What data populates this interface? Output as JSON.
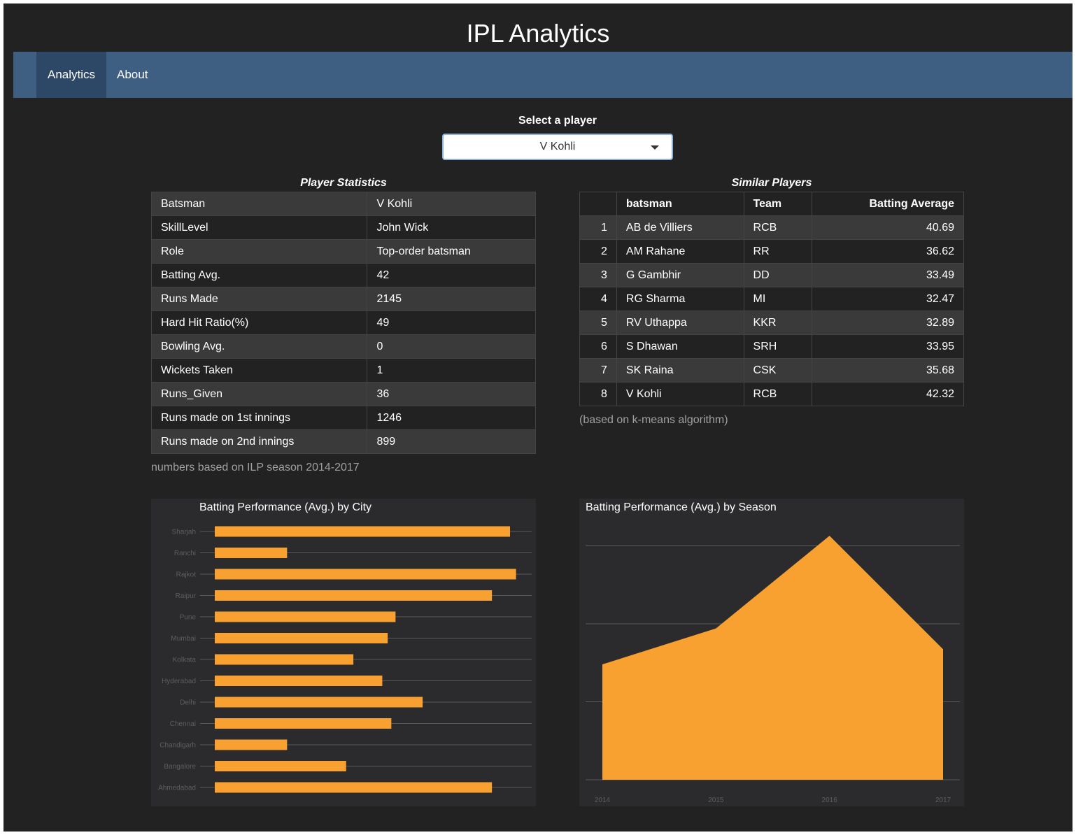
{
  "app": {
    "title": "IPL Analytics"
  },
  "nav": {
    "tabs": [
      {
        "label": "Analytics",
        "active": true
      },
      {
        "label": "About",
        "active": false
      }
    ]
  },
  "player_select": {
    "label": "Select a player",
    "value": "V Kohli"
  },
  "player_stats": {
    "caption": "Player Statistics",
    "rows": [
      {
        "label": "Batsman",
        "value": "V Kohli"
      },
      {
        "label": "SkillLevel",
        "value": "John Wick"
      },
      {
        "label": "Role",
        "value": "Top-order batsman"
      },
      {
        "label": "Batting Avg.",
        "value": "42"
      },
      {
        "label": "Runs Made",
        "value": "2145"
      },
      {
        "label": "Hard Hit Ratio(%)",
        "value": "49"
      },
      {
        "label": "Bowling Avg.",
        "value": "0"
      },
      {
        "label": "Wickets Taken",
        "value": "1"
      },
      {
        "label": "Runs_Given",
        "value": "36"
      },
      {
        "label": "Runs made on 1st innings",
        "value": "1246"
      },
      {
        "label": "Runs made on 2nd innings",
        "value": "899"
      }
    ],
    "note": "numbers based on ILP season 2014-2017"
  },
  "similar_players": {
    "caption": "Similar Players",
    "columns": [
      "",
      "batsman",
      "Team",
      "Batting Average"
    ],
    "rows": [
      {
        "rank": "1",
        "batsman": "AB de Villiers",
        "team": "RCB",
        "avg": "40.69"
      },
      {
        "rank": "2",
        "batsman": "AM Rahane",
        "team": "RR",
        "avg": "36.62"
      },
      {
        "rank": "3",
        "batsman": "G Gambhir",
        "team": "DD",
        "avg": "33.49"
      },
      {
        "rank": "4",
        "batsman": "RG Sharma",
        "team": "MI",
        "avg": "32.47"
      },
      {
        "rank": "5",
        "batsman": "RV Uthappa",
        "team": "KKR",
        "avg": "32.89"
      },
      {
        "rank": "6",
        "batsman": "S Dhawan",
        "team": "SRH",
        "avg": "33.95"
      },
      {
        "rank": "7",
        "batsman": "SK Raina",
        "team": "CSK",
        "avg": "35.68"
      },
      {
        "rank": "8",
        "batsman": "V Kohli",
        "team": "RCB",
        "avg": "42.32"
      }
    ],
    "note": "(based on k-means algorithm)"
  },
  "colors": {
    "bar": "#f8a030",
    "panel": "#2b2b2e",
    "nav": "#3e5f81",
    "nav_active": "#2d4866",
    "grid": "#5a5a5a",
    "tick": "#5e5e5e"
  },
  "chart_data": [
    {
      "type": "bar",
      "orientation": "horizontal",
      "title": "Batting Performance (Avg.) by City",
      "categories": [
        "Sharjah",
        "Ranchi",
        "Rajkot",
        "Raipur",
        "Pune",
        "Mumbai",
        "Kolkata",
        "Hyderabad",
        "Delhi",
        "Chennai",
        "Chandigarh",
        "Bangalore",
        "Ahmedabad"
      ],
      "values": [
        49,
        12,
        50,
        46,
        30,
        28.7,
        23,
        27.8,
        34.5,
        29.3,
        12,
        21.8,
        46
      ],
      "xlim": [
        0,
        52.6
      ],
      "grid": true,
      "legend": "none"
    },
    {
      "type": "area",
      "title": "Batting Performance (Avg.) by Season",
      "x": [
        "2014",
        "2015",
        "2016",
        "2017"
      ],
      "values": [
        30.5,
        40,
        64.5,
        34.5
      ],
      "ylim": [
        0,
        66
      ],
      "grid": true,
      "legend": "none"
    }
  ]
}
